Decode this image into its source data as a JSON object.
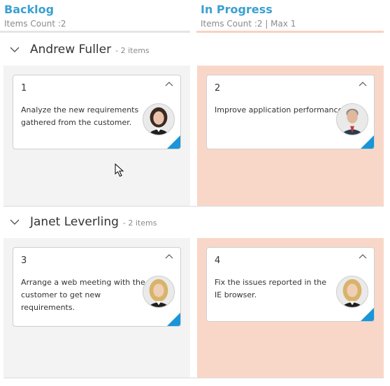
{
  "columns": [
    {
      "title": "Backlog",
      "count": "Items Count :2"
    },
    {
      "title": "In Progress",
      "count": "Items Count :2 | Max 1"
    }
  ],
  "swimlanes": [
    {
      "name": "Andrew Fuller",
      "count": "- 2 items",
      "cards": [
        {
          "id": "1",
          "text": "Analyze the new requirements gathered from the customer.",
          "avatar": "woman-avatar"
        },
        {
          "id": "2",
          "text": "Improve application performance",
          "avatar": "man-avatar"
        }
      ]
    },
    {
      "name": "Janet Leverling",
      "count": "- 2 items",
      "cards": [
        {
          "id": "3",
          "text": "Arrange a web meeting with the customer to get new requirements.",
          "avatar": "blonde-woman-avatar"
        },
        {
          "id": "4",
          "text": "Fix the issues reported in the IE browser.",
          "avatar": "blonde-woman-avatar"
        }
      ]
    }
  ],
  "colors": {
    "accent": "#3aa0d0",
    "progress_bg": "#f9d7c8",
    "backlog_bg": "#f3f3f3",
    "corner": "#1a95d8"
  }
}
